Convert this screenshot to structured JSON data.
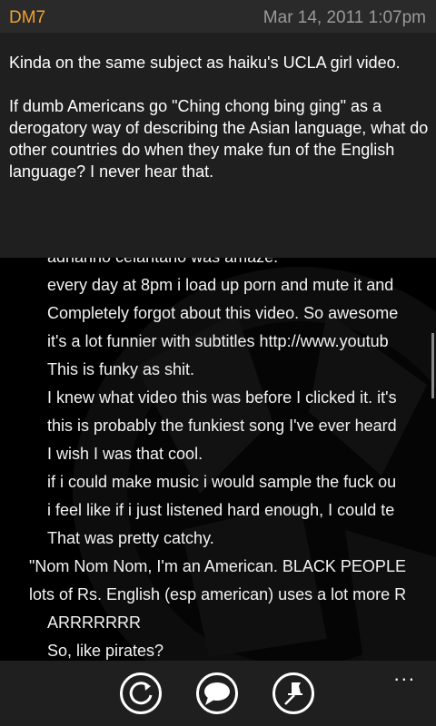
{
  "post": {
    "author": "DM7",
    "timestamp": "Mar 14, 2011 1:07pm",
    "paragraphs": [
      "Kinda on the same subject as haiku's UCLA girl video.",
      "If dumb Americans go \"Ching chong bing ging\" as a derogatory way of describing the Asian language, what do other countries do when they make fun of the English language? I never hear that."
    ]
  },
  "comments": [
    {
      "level": 2,
      "text": "adrianno celantano was amaze."
    },
    {
      "level": 2,
      "text": "every day at 8pm i load up porn and mute it and"
    },
    {
      "level": 2,
      "text": "Completely forgot about this video. So awesome"
    },
    {
      "level": 2,
      "text": "it's a lot funnier with subtitles http://www.youtub"
    },
    {
      "level": 2,
      "text": "This is funky as shit."
    },
    {
      "level": 2,
      "text": "I knew what video this was before I clicked it. it's"
    },
    {
      "level": 2,
      "text": "this is probably the funkiest song I've ever heard"
    },
    {
      "level": 2,
      "text": "I wish I was that cool."
    },
    {
      "level": 2,
      "text": "if i could make music i would sample the fuck ou"
    },
    {
      "level": 2,
      "text": "i feel like if i just listened hard enough, I could te"
    },
    {
      "level": 2,
      "text": "That was pretty catchy."
    },
    {
      "level": 1,
      "text": "\"Nom Nom Nom, I'm an American. BLACK PEOPLE"
    },
    {
      "level": 1,
      "text": "lots of Rs.  English (esp american) uses a lot more R"
    },
    {
      "level": 2,
      "text": "ARRRRRRR"
    },
    {
      "level": 2,
      "text": "So, like pirates?"
    }
  ],
  "app_bar": {
    "buttons": [
      {
        "icon": "refresh-icon"
      },
      {
        "icon": "comment-icon"
      },
      {
        "icon": "pin-icon"
      }
    ],
    "more_label": "..."
  }
}
